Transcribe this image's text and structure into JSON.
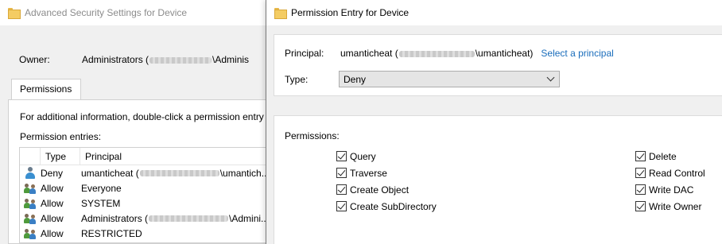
{
  "back_window": {
    "title": "Advanced Security Settings for Device",
    "owner_label": "Owner:",
    "owner_value_prefix": "Administrators (",
    "owner_value_suffix": "\\Adminis",
    "tab_permissions": "Permissions",
    "info_text": "For additional information, double-click a permission entry",
    "entries_label": "Permission entries:",
    "columns": {
      "type": "Type",
      "principal": "Principal"
    },
    "rows": [
      {
        "icon": "user-icon",
        "type": "Deny",
        "principal_prefix": "umanticheat (",
        "principal_suffix": "\\umantich...",
        "redacted": true
      },
      {
        "icon": "group-icon",
        "type": "Allow",
        "principal_prefix": "Everyone",
        "principal_suffix": "",
        "redacted": false
      },
      {
        "icon": "group-icon",
        "type": "Allow",
        "principal_prefix": "SYSTEM",
        "principal_suffix": "",
        "redacted": false
      },
      {
        "icon": "group-icon",
        "type": "Allow",
        "principal_prefix": "Administrators (",
        "principal_suffix": "\\Admini...",
        "redacted": true
      },
      {
        "icon": "group-icon",
        "type": "Allow",
        "principal_prefix": "RESTRICTED",
        "principal_suffix": "",
        "redacted": false
      }
    ]
  },
  "dialog": {
    "title": "Permission Entry for Device",
    "principal_label": "Principal:",
    "principal_prefix": "umanticheat (",
    "principal_suffix": "\\umanticheat)",
    "select_principal_link": "Select a principal",
    "type_label": "Type:",
    "type_value": "Deny",
    "permissions_label": "Permissions:",
    "permissions_left": [
      {
        "label": "Query",
        "checked": true
      },
      {
        "label": "Traverse",
        "checked": true
      },
      {
        "label": "Create Object",
        "checked": true
      },
      {
        "label": "Create SubDirectory",
        "checked": true
      }
    ],
    "permissions_right": [
      {
        "label": "Delete",
        "checked": true
      },
      {
        "label": "Read Control",
        "checked": true
      },
      {
        "label": "Write DAC",
        "checked": true
      },
      {
        "label": "Write Owner",
        "checked": true
      }
    ]
  },
  "colors": {
    "link": "#1a6dbb",
    "folder": "#f4cc63"
  }
}
